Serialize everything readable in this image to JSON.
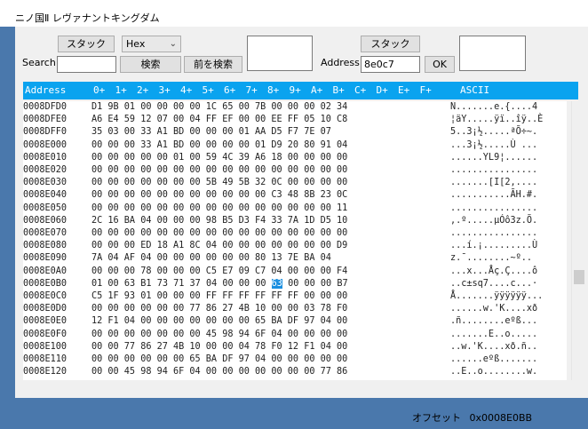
{
  "window": {
    "title": "ニノ国Ⅱ レヴァナントキングダム"
  },
  "toolbar": {
    "stack_left_label": "スタック",
    "mode_select": "Hex",
    "search_label": "Search",
    "search_value": "",
    "search_button": "検索",
    "prev_search_button": "前を検索",
    "stack_right_label": "スタック",
    "address_label": "Address",
    "address_value": "8e0c7",
    "ok_button": "OK"
  },
  "hex_header": {
    "address": "Address",
    "cols": [
      "0+",
      "1+",
      "2+",
      "3+",
      "4+",
      "5+",
      "6+",
      "7+",
      "8+",
      "9+",
      "A+",
      "B+",
      "C+",
      "D+",
      "E+",
      "F+"
    ],
    "ascii": "ASCII"
  },
  "rows": [
    {
      "addr": "0008DFD0",
      "hex": "D1 9B 01 00 00 00 00 1C 65 00 7B 00 00 00 02 34",
      "asc": "Ñ.......e.{....4"
    },
    {
      "addr": "0008DFE0",
      "hex": "A6 E4 59 12 07 00 04 FF EF 00 00 EE FF 05 10 C8",
      "asc": "¦äY.....ÿï..îÿ..È"
    },
    {
      "addr": "0008DFF0",
      "hex": "35 03 00 33 A1 BD 00 00 00 01 AA D5 F7 7E 07",
      "asc": "5..3¡½.....ªÕ÷~."
    },
    {
      "addr": "0008E000",
      "hex": "00 00 00 33 A1 BD 00 00 00 00 01 D9 20 80 91 04",
      "asc": "...3¡½.....Ù ..."
    },
    {
      "addr": "0008E010",
      "hex": "00 00 00 00 00 01 00 59 4C 39 A6 18 00 00 00 00",
      "asc": "......YL9¦......"
    },
    {
      "addr": "0008E020",
      "hex": "00 00 00 00 00 00 00 00 00 00 00 00 00 00 00 00",
      "asc": "................"
    },
    {
      "addr": "0008E030",
      "hex": "00 00 00 00 00 00 00 5B 49 5B 32 0C 00 00 00 00",
      "asc": ".......[I[2,...."
    },
    {
      "addr": "0008E040",
      "hex": "00 00 00 00 00 00 00 00 00 00 00 C3 48 8B 23 0C",
      "asc": "...........ÃH.#."
    },
    {
      "addr": "0008E050",
      "hex": "00 00 00 00 00 00 00 00 00 00 00 00 00 00 00 11",
      "asc": "................"
    },
    {
      "addr": "0008E060",
      "hex": "2C 16 BA 04 00 00 00 98 B5 D3 F4 33 7A 1D D5 10",
      "asc": ",.º.....µÓô3z.Õ."
    },
    {
      "addr": "0008E070",
      "hex": "00 00 00 00 00 00 00 00 00 00 00 00 00 00 00 00",
      "asc": "................"
    },
    {
      "addr": "0008E080",
      "hex": "00 00 00 ED 18 A1 8C 04 00 00 00 00 00 00 00 D9",
      "asc": "...í.¡.........Ù"
    },
    {
      "addr": "0008E090",
      "hex": "7A 04 AF 04 00 00 00 00 00 00 80 13 7E BA 04",
      "asc": "z.¯........~º.."
    },
    {
      "addr": "0008E0A0",
      "hex": "00 00 00 78 00 00 00 C5 E7 09 C7 04 00 00 00 F4",
      "asc": "...x...Åç.Ç....ô"
    },
    {
      "addr": "0008E0B0",
      "hex": "01 00 63 B1 73 71 37 04 00 00 00 63 00 00 00 B7",
      "asc": "..c±sq7....c...·"
    },
    {
      "addr": "0008E0C0",
      "hex": "C5 1F 93 01 00 00 00 FF FF FF FF FF FF 00 00 00",
      "asc": "Å.......ÿÿÿÿÿÿ..."
    },
    {
      "addr": "0008E0D0",
      "hex": "00 00 00 00 00 00 77 86 27 4B 10 00 00 03 78 F0",
      "asc": "......w.'K....xð"
    },
    {
      "addr": "0008E0E0",
      "hex": "12 F1 04 00 00 00 00 00 00 00 65 BA DF 97 04 00",
      "asc": ".ñ........eºß..."
    },
    {
      "addr": "0008E0F0",
      "hex": "00 00 00 00 00 00 00 45 98 94 6F 04 00 00 00 00",
      "asc": ".......E..o....."
    },
    {
      "addr": "0008E100",
      "hex": "00 00 77 86 27 4B 10 00 00 04 78 F0 12 F1 04 00",
      "asc": "..w.'K....xð.ñ.."
    },
    {
      "addr": "0008E110",
      "hex": "00 00 00 00 00 00 65 BA DF 97 04 00 00 00 00 00",
      "asc": "......eºß......."
    },
    {
      "addr": "0008E120",
      "hex": "00 00 45 98 94 6F 04 00 00 00 00 00 00 00 77 86",
      "asc": "..E..o........w."
    }
  ],
  "highlight": {
    "row": 14,
    "byte": 11
  },
  "status": {
    "offset_label": "オフセット",
    "offset_value": "0x0008E0BB"
  },
  "colors": {
    "header_bg": "#0aa3ef",
    "highlight_bg": "#1a8fe0",
    "desktop_bg": "#4a78ac"
  }
}
